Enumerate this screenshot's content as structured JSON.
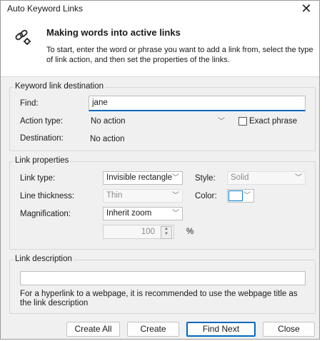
{
  "window": {
    "title": "Auto Keyword Links",
    "close_glyph": "✕"
  },
  "header": {
    "title": "Making words into active links",
    "description": "To start, enter the word or phrase you want to add a link from, select the type of link action, and then set the properties of the links."
  },
  "destination_group": {
    "label": "Keyword link destination",
    "find_label": "Find:",
    "find_value": "jane",
    "action_label": "Action type:",
    "action_value": "No action",
    "exact_phrase_label": "Exact phrase",
    "exact_phrase_checked": false,
    "destination_label": "Destination:",
    "destination_value": "No action"
  },
  "properties_group": {
    "label": "Link properties",
    "link_type_label": "Link type:",
    "link_type_value": "Invisible rectangle",
    "style_label": "Style:",
    "style_value": "Solid",
    "thickness_label": "Line thickness:",
    "thickness_value": "Thin",
    "color_label": "Color:",
    "color_value": "#ffffff",
    "magnification_label": "Magnification:",
    "magnification_value": "Inherit zoom",
    "zoom_value": "100",
    "zoom_unit": "%"
  },
  "description_group": {
    "label": "Link description",
    "input_value": "",
    "hint": "For a hyperlink to a webpage, it is recommended to use the webpage title as the link description"
  },
  "buttons": {
    "create_all": "Create All",
    "create": "Create",
    "find_next": "Find Next",
    "close": "Close"
  },
  "colors": {
    "accent": "#0067c0",
    "dialog_bg": "#f0f0f0"
  }
}
